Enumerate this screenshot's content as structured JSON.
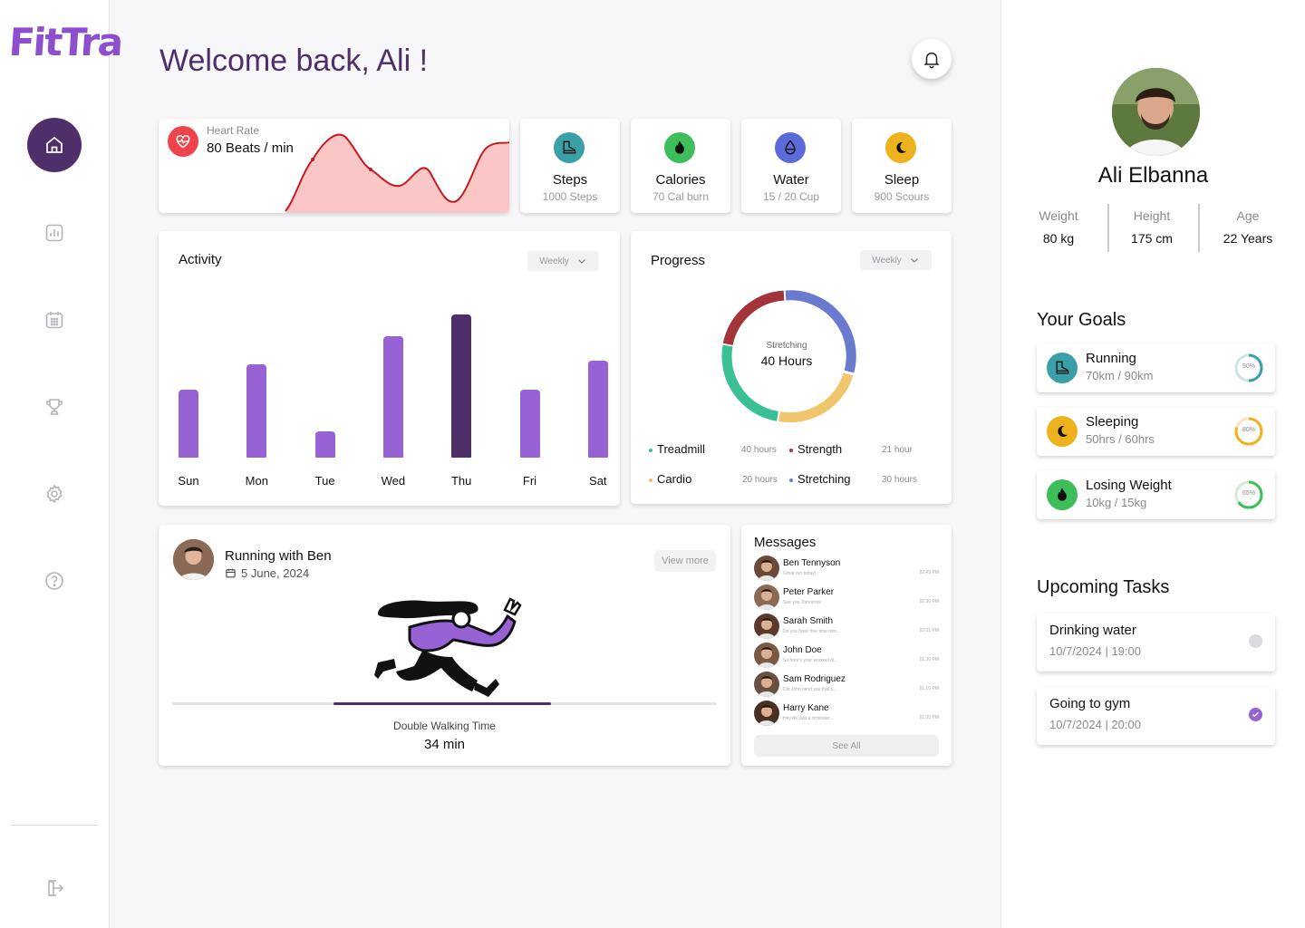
{
  "app": {
    "logo_text": "FitTra"
  },
  "sidebar": {
    "items": [
      {
        "name": "home",
        "active": true
      },
      {
        "name": "stats",
        "active": false
      },
      {
        "name": "calendar",
        "active": false
      },
      {
        "name": "trophy",
        "active": false
      },
      {
        "name": "settings",
        "active": false
      },
      {
        "name": "help",
        "active": false
      }
    ],
    "logout": "logout"
  },
  "header": {
    "welcome": "Welcome back, Ali !"
  },
  "heart_rate": {
    "label": "Heart Rate",
    "value": "80 Beats / min"
  },
  "stats": [
    {
      "title": "Steps",
      "sub": "1000 Steps",
      "icon": "boot-icon",
      "color": "#3aa0a8"
    },
    {
      "title": "Calories",
      "sub": "70 Cal burn",
      "icon": "flame-icon",
      "color": "#3dbe5a"
    },
    {
      "title": "Water",
      "sub": "15 / 20 Cup",
      "icon": "drop-icon",
      "color": "#5b6bd9"
    },
    {
      "title": "Sleep",
      "sub": "900 Scours",
      "icon": "moon-icon",
      "color": "#efb21f"
    }
  ],
  "activity": {
    "title": "Activity",
    "dropdown": "Weekly",
    "days": [
      "Sun",
      "Mon",
      "Tue",
      "Wed",
      "Thu",
      "Fri",
      "Sat"
    ],
    "values": [
      75,
      103,
      29,
      134,
      158,
      75,
      107
    ],
    "highlight_index": 4
  },
  "progress": {
    "title": "Progress",
    "dropdown": "Weekly",
    "center_label": "Stretching",
    "center_value": "40 Hours",
    "legend": [
      {
        "name": "Treadmill",
        "value": "40 hours",
        "color": "#3bbf95"
      },
      {
        "name": "Strength",
        "value": "21 hour",
        "color": "#a2343a"
      },
      {
        "name": "Cardio",
        "value": "20 hours",
        "color": "#f0b66d"
      },
      {
        "name": "Stretching",
        "value": "30 hours",
        "color": "#6a7bcf"
      }
    ]
  },
  "run": {
    "title": "Running with Ben",
    "date": "5 June, 2024",
    "view_more": "View more",
    "metric_label": "Double Walking Time",
    "metric_value": "34 min",
    "progress": 0.4
  },
  "messages": {
    "title": "Messages",
    "items": [
      {
        "name": "Ben Tennyson",
        "preview": "Great run today!",
        "time": "02:45 PM"
      },
      {
        "name": "Peter Parker",
        "preview": "See you Tomorrow",
        "time": "02:30 PM"
      },
      {
        "name": "Sarah Smith",
        "preview": "Do you have free time tom...",
        "time": "02:01 PM"
      },
      {
        "name": "John Doe",
        "preview": "So here's your workout pl...",
        "time": "01:30 PM"
      },
      {
        "name": "Sam Rodriguez",
        "preview": "Did John send you that p...",
        "time": "01:10 PM"
      },
      {
        "name": "Harry Kane",
        "preview": "Hey Ali, just a reminder...",
        "time": "01:05 PM"
      }
    ],
    "see_all": "See All"
  },
  "profile": {
    "name": "Ali Elbanna",
    "metrics": [
      {
        "label": "Weight",
        "value": "80 kg"
      },
      {
        "label": "Height",
        "value": "175 cm"
      },
      {
        "label": "Age",
        "value": "22 Years"
      }
    ]
  },
  "goals": {
    "title": "Your Goals",
    "items": [
      {
        "title": "Running",
        "sub": "70km / 90km",
        "percent": "50%",
        "fraction": 0.5,
        "color": "#3aa0a8",
        "icon": "boot-icon"
      },
      {
        "title": "Sleeping",
        "sub": "50hrs / 60hrs",
        "percent": "80%",
        "fraction": 0.8,
        "color": "#efb21f",
        "icon": "moon-icon"
      },
      {
        "title": "Losing Weight",
        "sub": "10kg / 15kg",
        "percent": "65%",
        "fraction": 0.65,
        "color": "#3dbe5a",
        "icon": "flame-icon"
      }
    ]
  },
  "tasks": {
    "title": "Upcoming Tasks",
    "items": [
      {
        "title": "Drinking water",
        "sub": "10/7/2024 | 19:00",
        "done": false
      },
      {
        "title": "Going to gym",
        "sub": "10/7/2024 | 20:00",
        "done": true
      }
    ]
  }
}
